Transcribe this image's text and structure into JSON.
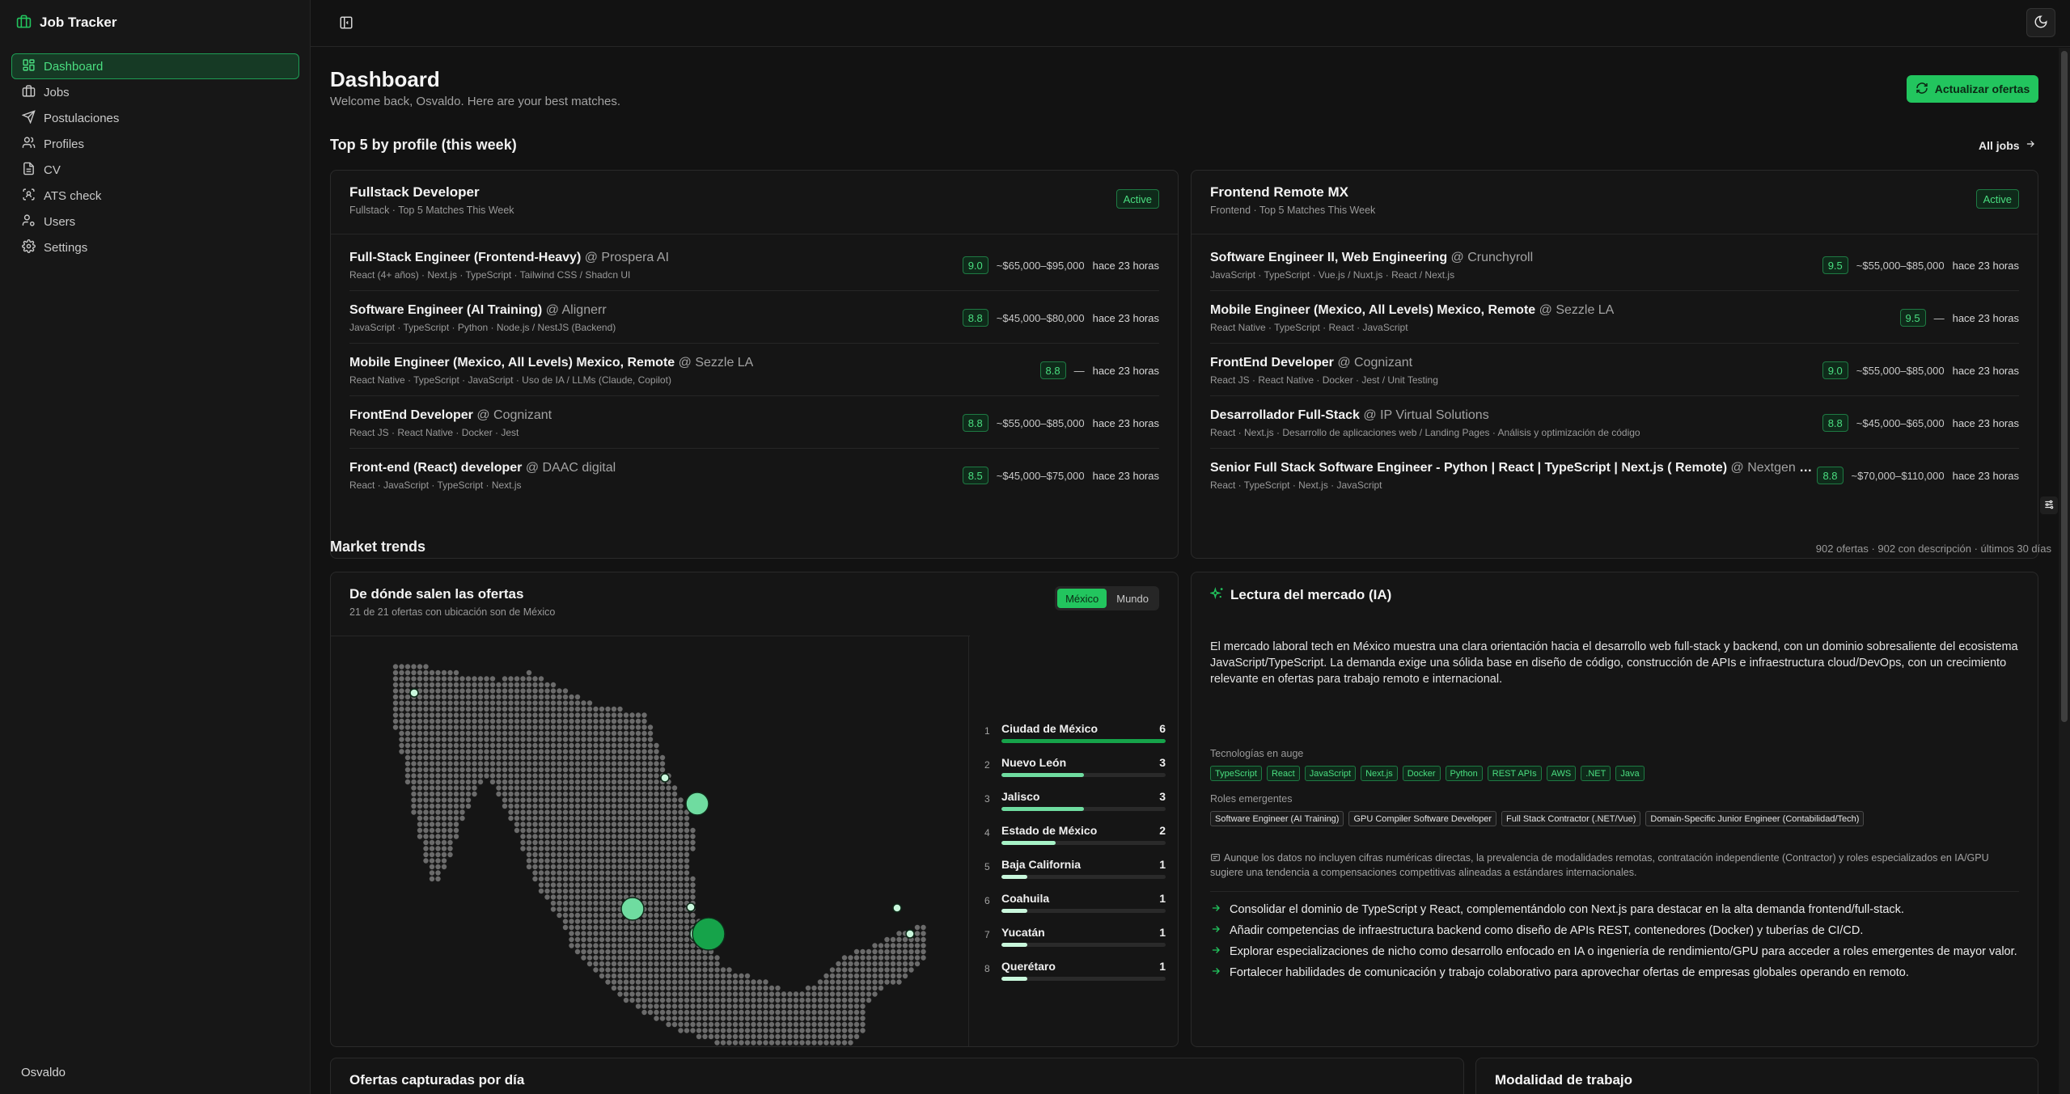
{
  "brand": {
    "name": "Job Tracker"
  },
  "sidebar": {
    "items": [
      {
        "label": "Dashboard",
        "icon": "dashboard-icon",
        "active": true
      },
      {
        "label": "Jobs",
        "icon": "briefcase-icon"
      },
      {
        "label": "Postulaciones",
        "icon": "send-icon"
      },
      {
        "label": "Profiles",
        "icon": "users-icon"
      },
      {
        "label": "CV",
        "icon": "file-icon"
      },
      {
        "label": "ATS check",
        "icon": "scan-icon"
      },
      {
        "label": "Users",
        "icon": "user-cog-icon"
      },
      {
        "label": "Settings",
        "icon": "gear-icon"
      }
    ],
    "user": "Osvaldo"
  },
  "header": {
    "title": "Dashboard",
    "subtitle": "Welcome back, Osvaldo. Here are your best matches.",
    "refresh_label": "Actualizar ofertas"
  },
  "top5": {
    "title": "Top 5 by profile (this week)",
    "all_jobs": "All jobs",
    "profiles": [
      {
        "name": "Fullstack Developer",
        "subtitle": "Fullstack · Top 5 Matches This Week",
        "status": "Active",
        "jobs": [
          {
            "title": "Full-Stack Engineer (Frontend-Heavy)",
            "company": "@ Prospera AI",
            "tags": "React (4+ años) · Next.js · TypeScript · Tailwind CSS / Shadcn UI",
            "score": "9.0",
            "salary": "~$65,000–$95,000",
            "time": "hace 23 horas"
          },
          {
            "title": "Software Engineer (AI Training)",
            "company": "@ Alignerr",
            "tags": "JavaScript · TypeScript · Python · Node.js / NestJS (Backend)",
            "score": "8.8",
            "salary": "~$45,000–$80,000",
            "time": "hace 23 horas"
          },
          {
            "title": "Mobile Engineer (Mexico, All Levels) Mexico, Remote",
            "company": "@ Sezzle LA",
            "tags": "React Native · TypeScript · JavaScript · Uso de IA / LLMs (Claude, Copilot)",
            "score": "8.8",
            "salary": "—",
            "time": "hace 23 horas"
          },
          {
            "title": "FrontEnd Developer",
            "company": "@ Cognizant",
            "tags": "React JS · React Native · Docker · Jest",
            "score": "8.8",
            "salary": "~$55,000–$85,000",
            "time": "hace 23 horas"
          },
          {
            "title": "Front-end (React) developer",
            "company": "@ DAAC digital",
            "tags": "React · JavaScript · TypeScript · Next.js",
            "score": "8.5",
            "salary": "~$45,000–$75,000",
            "time": "hace 23 horas"
          }
        ]
      },
      {
        "name": "Frontend Remote MX",
        "subtitle": "Frontend · Top 5 Matches This Week",
        "status": "Active",
        "jobs": [
          {
            "title": "Software Engineer II, Web Engineering",
            "company": "@ Crunchyroll",
            "tags": "JavaScript · TypeScript · Vue.js / Nuxt.js · React / Next.js",
            "score": "9.5",
            "salary": "~$55,000–$85,000",
            "time": "hace 23 horas"
          },
          {
            "title": "Mobile Engineer (Mexico, All Levels) Mexico, Remote",
            "company": "@ Sezzle LA",
            "tags": "React Native · TypeScript · React · JavaScript",
            "score": "9.5",
            "salary": "—",
            "time": "hace 23 horas"
          },
          {
            "title": "FrontEnd Developer",
            "company": "@ Cognizant",
            "tags": "React JS · React Native · Docker · Jest / Unit Testing",
            "score": "9.0",
            "salary": "~$55,000–$85,000",
            "time": "hace 23 horas"
          },
          {
            "title": "Desarrollador Full-Stack",
            "company": "@ IP Virtual Solutions",
            "tags": "React · Next.js · Desarrollo de aplicaciones web / Landing Pages · Análisis y optimización de código",
            "score": "8.8",
            "salary": "~$45,000–$65,000",
            "time": "hace 23 horas"
          },
          {
            "title": "Senior Full Stack Software Engineer - Python | React | TypeScript | Next.js ( Remote)",
            "company": "@ Nextgen V...",
            "tags": "React · TypeScript · Next.js · JavaScript",
            "score": "8.8",
            "salary": "~$70,000–$110,000",
            "time": "hace 23 horas"
          }
        ]
      }
    ]
  },
  "market": {
    "title": "Market trends",
    "caption": "902 ofertas · 902 con descripción · últimos 30 días",
    "origin": {
      "title": "De dónde salen las ofertas",
      "subtitle": "21 de 21 ofertas con ubicación son de México",
      "toggle": [
        "México",
        "Mundo"
      ],
      "ranking": [
        {
          "rank": "1",
          "state": "Ciudad de México",
          "count": "6",
          "fraction": 1.0,
          "color": "#16a34a"
        },
        {
          "rank": "2",
          "state": "Nuevo León",
          "count": "3",
          "fraction": 0.5,
          "color": "#6fdca0"
        },
        {
          "rank": "3",
          "state": "Jalisco",
          "count": "3",
          "fraction": 0.5,
          "color": "#6fdca0"
        },
        {
          "rank": "4",
          "state": "Estado de México",
          "count": "2",
          "fraction": 0.33,
          "color": "#a7f3c7"
        },
        {
          "rank": "5",
          "state": "Baja California",
          "count": "1",
          "fraction": 0.16,
          "color": "#c9f7dc"
        },
        {
          "rank": "6",
          "state": "Coahuila",
          "count": "1",
          "fraction": 0.16,
          "color": "#c9f7dc"
        },
        {
          "rank": "7",
          "state": "Yucatán",
          "count": "1",
          "fraction": 0.16,
          "color": "#c9f7dc"
        },
        {
          "rank": "8",
          "state": "Querétaro",
          "count": "1",
          "fraction": 0.16,
          "color": "#c9f7dc"
        }
      ]
    },
    "ai": {
      "title": "Lectura del mercado (IA)",
      "summary": "El mercado laboral tech en México muestra una clara orientación hacia el desarrollo web full-stack y backend, con un dominio sobresaliente del ecosistema JavaScript/TypeScript. La demanda exige una sólida base en diseño de código, construcción de APIs e infraestructura cloud/DevOps, con un crecimiento relevante en ofertas para trabajo remoto e internacional.",
      "tech_label": "Tecnologías en auge",
      "tech": [
        "TypeScript",
        "React",
        "JavaScript",
        "Next.js",
        "Docker",
        "Python",
        "REST APIs",
        "AWS",
        ".NET",
        "Java"
      ],
      "roles_label": "Roles emergentes",
      "roles": [
        "Software Engineer (AI Training)",
        "GPU Compiler Software Developer",
        "Full Stack Contractor (.NET/Vue)",
        "Domain-Specific Junior Engineer (Contabilidad/Tech)"
      ],
      "note": "Aunque los datos no incluyen cifras numéricas directas, la prevalencia de modalidades remotas, contratación independiente (Contractor) y roles especializados en IA/GPU sugiere una tendencia a compensaciones competitivas alineadas a estándares internacionales.",
      "recommendations": [
        "Consolidar el dominio de TypeScript y React, complementándolo con Next.js para destacar en la alta demanda frontend/full-stack.",
        "Añadir competencias de infraestructura backend como diseño de APIs REST, contenedores (Docker) y tuberías de CI/CD.",
        "Explorar especializaciones de nicho como desarrollo enfocado en IA o ingeniería de rendimiento/GPU para acceder a roles emergentes de mayor valor.",
        "Fortalecer habilidades de comunicación y trabajo colaborativo para aprovechar ofertas de empresas globales operando en remoto."
      ]
    },
    "daily_title": "Ofertas capturadas por día",
    "modality_title": "Modalidad de trabajo"
  }
}
